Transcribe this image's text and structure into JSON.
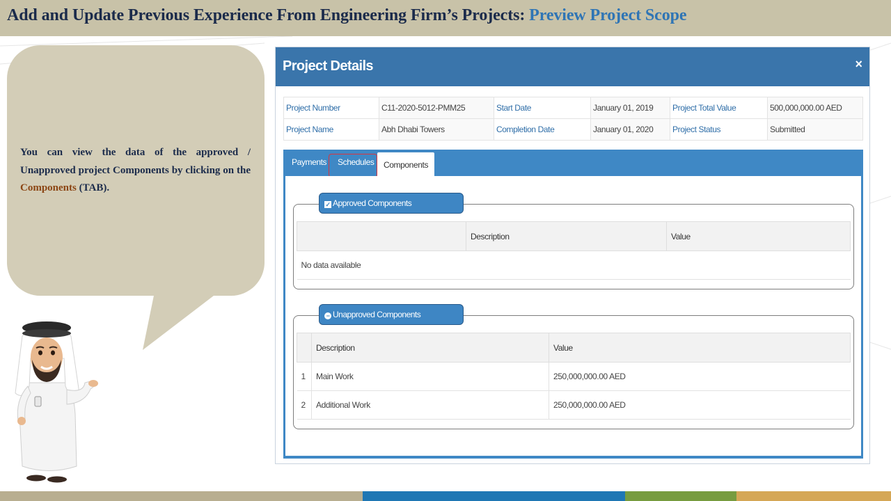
{
  "slide": {
    "title_main": "Add and Update Previous Experience From Engineering Firm’s Projects: ",
    "title_accent": "Preview Project Scope",
    "bubble_part1": "You can view the data of the approved / Unapproved project Components by clicking on the ",
    "bubble_keyword": "Components",
    "bubble_part2": " (TAB).",
    "colors": {
      "header": "#c8c2a8",
      "bubble": "#d3cdb7",
      "accent": "#2f75b5",
      "footer": [
        "#b8ae90",
        "#1f77b4",
        "#779c3f",
        "#d5a756"
      ]
    }
  },
  "modal": {
    "title": "Project Details",
    "close_icon": "×",
    "info": {
      "project_number_label": "Project Number",
      "project_number": "C11-2020-5012-PMM25",
      "start_date_label": "Start Date",
      "start_date": "January 01, 2019",
      "total_value_label": "Project Total Value",
      "total_value": "500,000,000.00 AED",
      "project_name_label": "Project Name",
      "project_name": "Abh Dhabi Towers",
      "completion_date_label": "Completion Date",
      "completion_date": "January 01, 2020",
      "status_label": "Project Status",
      "status": "Submitted"
    },
    "tabs": {
      "payments": "Payments",
      "schedules": "Schedules",
      "components": "Components",
      "active": "components"
    },
    "approved": {
      "legend": "Approved Components",
      "icon": "check-square-icon",
      "col_description": "Description",
      "col_value": "Value",
      "empty": "No data available"
    },
    "unapproved": {
      "legend": "Unapproved Components",
      "icon": "minus-circle-icon",
      "col_description": "Description",
      "col_value": "Value",
      "rows": [
        {
          "num": "1",
          "description": "Main Work",
          "value": "250,000,000.00 AED"
        },
        {
          "num": "2",
          "description": "Additional Work",
          "value": "250,000,000.00 AED"
        }
      ]
    }
  }
}
